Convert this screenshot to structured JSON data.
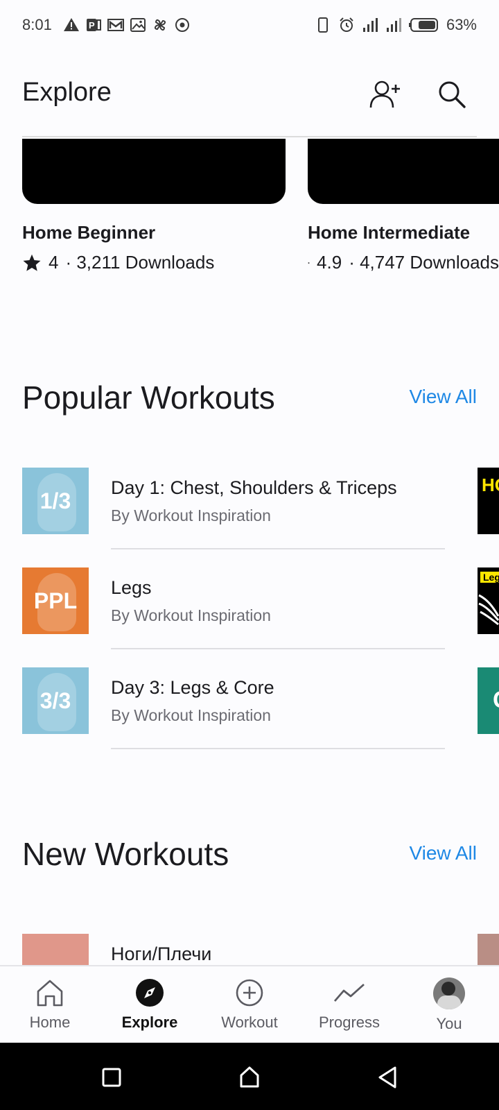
{
  "status_bar": {
    "time": "8:01",
    "battery": "63%",
    "left_icons": [
      "warning-icon",
      "parking-icon",
      "gmail-icon",
      "gallery-icon",
      "pinwheel-icon",
      "record-icon"
    ],
    "right_icons": [
      "vibrate-icon",
      "alarm-icon",
      "signal-icon",
      "signal-icon",
      "battery-icon"
    ]
  },
  "header": {
    "title": "Explore",
    "icons": [
      "add-person-icon",
      "search-icon"
    ]
  },
  "plans": [
    {
      "title": "Home Beginner",
      "rating": "4",
      "downloads": "· 3,211 Downloads"
    },
    {
      "title": "Home Intermediate",
      "rating": "4.9",
      "downloads": "· 4,747 Downloads"
    }
  ],
  "popular": {
    "title": "Popular Workouts",
    "view_all": "View All",
    "items": [
      {
        "thumb": "1/3",
        "thumb_color": "#8ac3da",
        "title": "Day 1: Chest, Shoulders & Triceps",
        "author": "By Workout Inspiration"
      },
      {
        "thumb": "PPL",
        "thumb_color": "#e67a32",
        "title": "Legs",
        "author": "By Workout Inspiration"
      },
      {
        "thumb": "3/3",
        "thumb_color": "#8ac3da",
        "title": "Day 3: Legs & Core",
        "author": "By Workout Inspiration"
      }
    ],
    "peek_cards": [
      {
        "text": "HO",
        "bg": "#000000",
        "fg": "#ffe600"
      },
      {
        "text": "Leg",
        "bg": "#000000",
        "fg": "#000000"
      },
      {
        "text": "C",
        "bg": "#1a8a74",
        "fg": "#ffffff"
      }
    ]
  },
  "new_workouts": {
    "title": "New Workouts",
    "view_all": "View All",
    "items": [
      {
        "title": "Ноги/Плечи",
        "thumb_color": "#e0978a"
      }
    ]
  },
  "bottom_nav": [
    {
      "label": "Home",
      "icon": "home-icon",
      "active": false
    },
    {
      "label": "Explore",
      "icon": "compass-icon",
      "active": true
    },
    {
      "label": "Workout",
      "icon": "plus-circle-icon",
      "active": false
    },
    {
      "label": "Progress",
      "icon": "trend-icon",
      "active": false
    },
    {
      "label": "You",
      "icon": "avatar",
      "active": false
    }
  ],
  "system_nav": [
    "recents-icon",
    "home-system-icon",
    "back-icon"
  ],
  "colors": {
    "accent": "#1e88e5",
    "text": "#1b1b1f",
    "muted": "#6b6b72",
    "background": "#fcfcfe"
  }
}
